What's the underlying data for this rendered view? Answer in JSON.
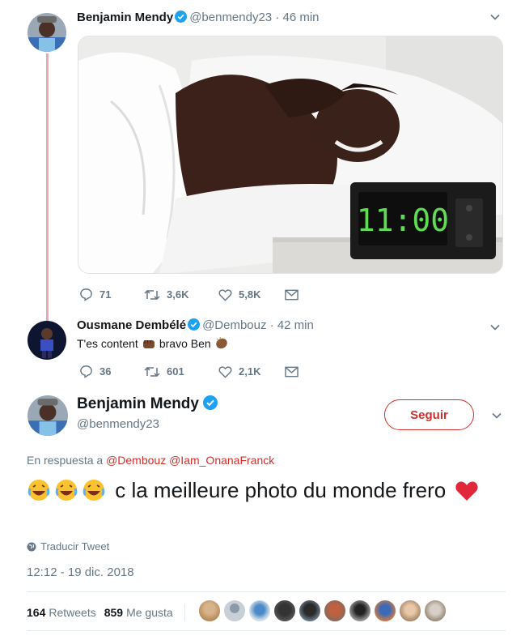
{
  "tweet1": {
    "name": "Benjamin Mendy",
    "handle": "@benmendy23",
    "time": "· 46 min",
    "stats": {
      "replies": "71",
      "retweets": "3,6K",
      "likes": "5,8K"
    },
    "image": {
      "clock_display": "11:00"
    }
  },
  "tweet2": {
    "name": "Ousmane Dembélé",
    "handle": "@Dembouz",
    "time": "· 42 min",
    "text_before": "T'es content",
    "text_after": "bravo Ben",
    "stats": {
      "replies": "36",
      "retweets": "601",
      "likes": "2,1K"
    }
  },
  "main": {
    "name": "Benjamin Mendy",
    "handle": "@benmendy23",
    "follow_label": "Seguir",
    "in_reply_prefix": "En respuesta a",
    "mention1": "@Dembouz",
    "mention2": "@Iam_OnanaFranck",
    "text": "c la meilleure photo du monde frero",
    "translate_label": "Traducir Tweet",
    "timestamp": "12:12 - 19 dic. 2018",
    "retweets_count": "164",
    "retweets_label": "Retweets",
    "likes_count": "859",
    "likes_label": "Me gusta"
  },
  "colors": {
    "accent": "#d0302c",
    "thread_line": "#e8aab2",
    "verified": "#1da1f2",
    "muted": "#657786"
  },
  "icons": [
    "reply-icon",
    "retweet-icon",
    "like-icon",
    "message-icon",
    "verified-icon",
    "chevron-down-icon",
    "globe-icon",
    "heart-icon",
    "laughing-emoji-icon",
    "fist-emoji-icon",
    "clap-emoji-icon"
  ]
}
